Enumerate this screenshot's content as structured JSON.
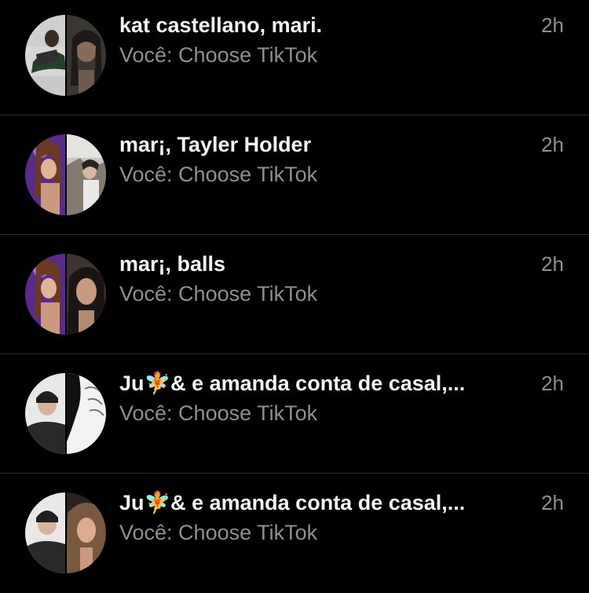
{
  "conversations": [
    {
      "name": "kat castellano, mari.",
      "preview": "Você: Choose TikTok",
      "time": "2h",
      "avatar_left": "portrait-photo",
      "avatar_right": "portrait-photo"
    },
    {
      "name": "mar¡, Tayler Holder",
      "preview": "Você: Choose TikTok",
      "time": "2h",
      "avatar_left": "portrait-photo",
      "avatar_right": "portrait-photo"
    },
    {
      "name": "mar¡, balls",
      "preview": "Você: Choose TikTok",
      "time": "2h",
      "avatar_left": "portrait-photo",
      "avatar_right": "portrait-photo"
    },
    {
      "name": "Ju🧚& e amanda conta de casal,...",
      "preview": "Você: Choose TikTok",
      "time": "2h",
      "avatar_left": "portrait-photo",
      "avatar_right": "sketch-image"
    },
    {
      "name": "Ju🧚& e amanda conta de casal,...",
      "preview": "Você: Choose TikTok",
      "time": "2h",
      "avatar_left": "portrait-photo",
      "avatar_right": "portrait-photo"
    }
  ],
  "colors": {
    "background": "#000000",
    "primary_text": "#f4f4f4",
    "secondary_text": "#8e8e93",
    "divider": "#2c2c2e"
  }
}
